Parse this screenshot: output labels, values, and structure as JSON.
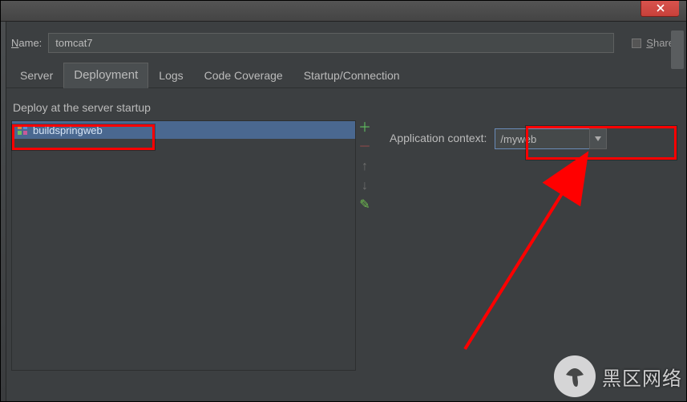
{
  "titlebar": {
    "close_glyph": "×"
  },
  "name": {
    "label_prefix": "N",
    "label_rest": "ame:",
    "value": "tomcat7"
  },
  "share": {
    "prefix": "S",
    "rest": "hare"
  },
  "tabs": {
    "server": "Server",
    "deployment": "Deployment",
    "logs": "Logs",
    "code_coverage": "Code Coverage",
    "startup": "Startup/Connection"
  },
  "section": {
    "deploy_title": "Deploy at the server startup"
  },
  "deploy_items": [
    {
      "label": "buildspringweb"
    }
  ],
  "list_icons": {
    "plus": "＋",
    "minus": "－",
    "up": "↑",
    "down": "↓",
    "pencil": "✎"
  },
  "context": {
    "label": "Application context:",
    "value": "/myweb"
  },
  "watermark": {
    "text": "黑区网络"
  }
}
